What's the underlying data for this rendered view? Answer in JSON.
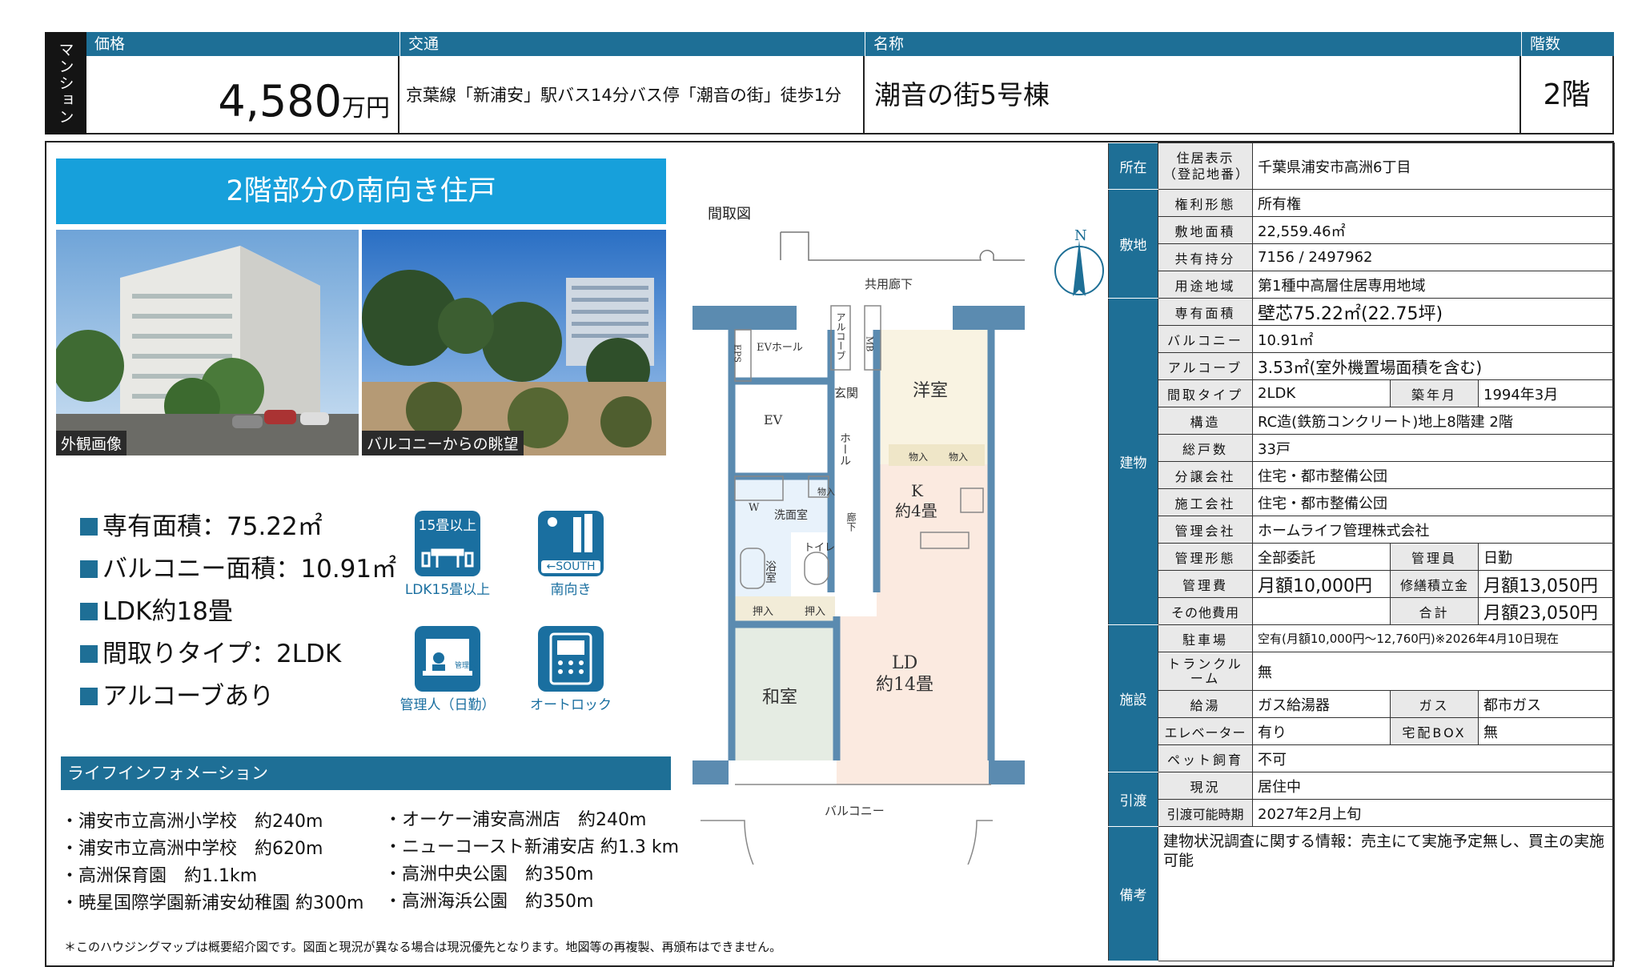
{
  "header": {
    "type_label": "マンション",
    "price_label": "価格",
    "price_value": "4,580",
    "price_unit": "万円",
    "traffic_label": "交通",
    "traffic_value": "京葉線「新浦安」駅バス14分バス停「潮音の街」徒歩1分",
    "name_label": "名称",
    "name_value": "潮音の街5号棟",
    "floor_label": "階数",
    "floor_value": "2階"
  },
  "headline": "2階部分の南向き住戸",
  "photos": [
    {
      "caption": "外観画像"
    },
    {
      "caption": "バルコニーからの眺望"
    }
  ],
  "features": [
    "専有面積：75.22㎡",
    "バルコニー面積：10.91㎡",
    "LDK約18畳",
    "間取りタイプ：2LDK",
    "アルコーブあり"
  ],
  "icons": [
    {
      "icon": "ldk15-icon",
      "badge": "15畳以上",
      "label": "LDK15畳以上"
    },
    {
      "icon": "south-icon",
      "badge": "←SOUTH",
      "label": "南向き"
    },
    {
      "icon": "manager-icon",
      "badge": "管理人",
      "label": "管理人（日勤）"
    },
    {
      "icon": "autolock-icon",
      "label": "オートロック"
    }
  ],
  "life": {
    "title": "ライフインフォメーション",
    "left": [
      "・浦安市立高洲小学校　約240m",
      "・浦安市立高洲中学校　約620m",
      "・高洲保育園　約1.1km",
      "・暁星国際学園新浦安幼稚園 約300m"
    ],
    "right": [
      "・オーケー浦安高洲店　約240m",
      "・ニューコースト新浦安店 約1.3 km",
      "・高洲中央公園　約350m",
      "・高洲海浜公園　約350m"
    ]
  },
  "floorplan": {
    "title": "間取図",
    "compass": "N",
    "corridor": "共用廊下",
    "balcony": "バルコニー",
    "eps": "EPS",
    "evhall": "EVホール",
    "alcove": "アルコーブ",
    "mb": "MB",
    "ev": "EV",
    "genkan": "玄関",
    "hall": "ホール",
    "youshitsu": "洋室",
    "storage": "物入",
    "senmen": "洗面室",
    "w": "W",
    "rouka": "廊下",
    "k_label": "K",
    "k_size": "約4畳",
    "yokushitsu": "浴室",
    "toilet": "トイレ",
    "oshiire": "押入",
    "washitsu": "和室",
    "ld_label": "LD",
    "ld_size": "約14畳"
  },
  "note": "＊このハウジングマップは概要紹介図です。図面と現況が異なる場合は現況優先となります。地図等の再複製、再頒布はできません。",
  "spec": {
    "sec_location": "所在",
    "address_label": "住居表示\n（登記地番）",
    "address": "千葉県浦安市高洲6丁目",
    "sec_site": "敷地",
    "rights_label": "権利形態",
    "rights": "所有権",
    "site_area_label": "敷地面積",
    "site_area": "22,559.46㎡",
    "share_label": "共有持分",
    "share": "7156 / 2497962",
    "zone_label": "用途地域",
    "zone": "第1種中高層住居専用地域",
    "sec_building": "建物",
    "area_label": "専有面積",
    "area": "壁芯75.22㎡(22.75坪)",
    "balcony_label": "バルコニー",
    "balcony": "10.91㎡",
    "alcove_label": "アルコーブ",
    "alcove": "3.53㎡(室外機置場面積を含む)",
    "layout_label": "間取タイプ",
    "layout": "2LDK",
    "built_label": "築年月",
    "built": "1994年3月",
    "structure_label": "構造",
    "structure": "RC造(鉄筋コンクリート)地上8階建 2階",
    "units_label": "総戸数",
    "units": "33戸",
    "seller_label": "分譲会社",
    "seller": "住宅・都市整備公団",
    "builder_label": "施工会社",
    "builder": "住宅・都市整備公団",
    "mgmt_co_label": "管理会社",
    "mgmt_co": "ホームライフ管理株式会社",
    "mgmt_form_label": "管理形態",
    "mgmt_form": "全部委託",
    "manager_label": "管理員",
    "manager": "日勤",
    "mgmt_fee_label": "管理費",
    "mgmt_fee": "月額10,000円",
    "repair_label": "修繕積立金",
    "repair": "月額13,050円",
    "other_label": "その他費用",
    "other": "",
    "total_label": "合計",
    "total": "月額23,050円",
    "sec_facility": "施設",
    "parking_label": "駐車場",
    "parking": "空有(月額10,000円～12,760円)※2026年4月10日現在",
    "trunk_label": "トランクルーム",
    "trunk": "無",
    "water_label": "給湯",
    "water": "ガス給湯器",
    "gas_label": "ガス",
    "gas": "都市ガス",
    "elevator_label": "エレベーター",
    "elevator": "有り",
    "box_label": "宅配BOX",
    "box": "無",
    "pet_label": "ペット飼育",
    "pet": "不可",
    "sec_handover": "引渡",
    "status_label": "現況",
    "status": "居住中",
    "handover_label": "引渡可能時期",
    "handover": "2027年2月上旬",
    "sec_remarks": "備考",
    "remarks": "建物状況調査に関する情報：売主にて実施予定無し、買主の実施可能"
  }
}
